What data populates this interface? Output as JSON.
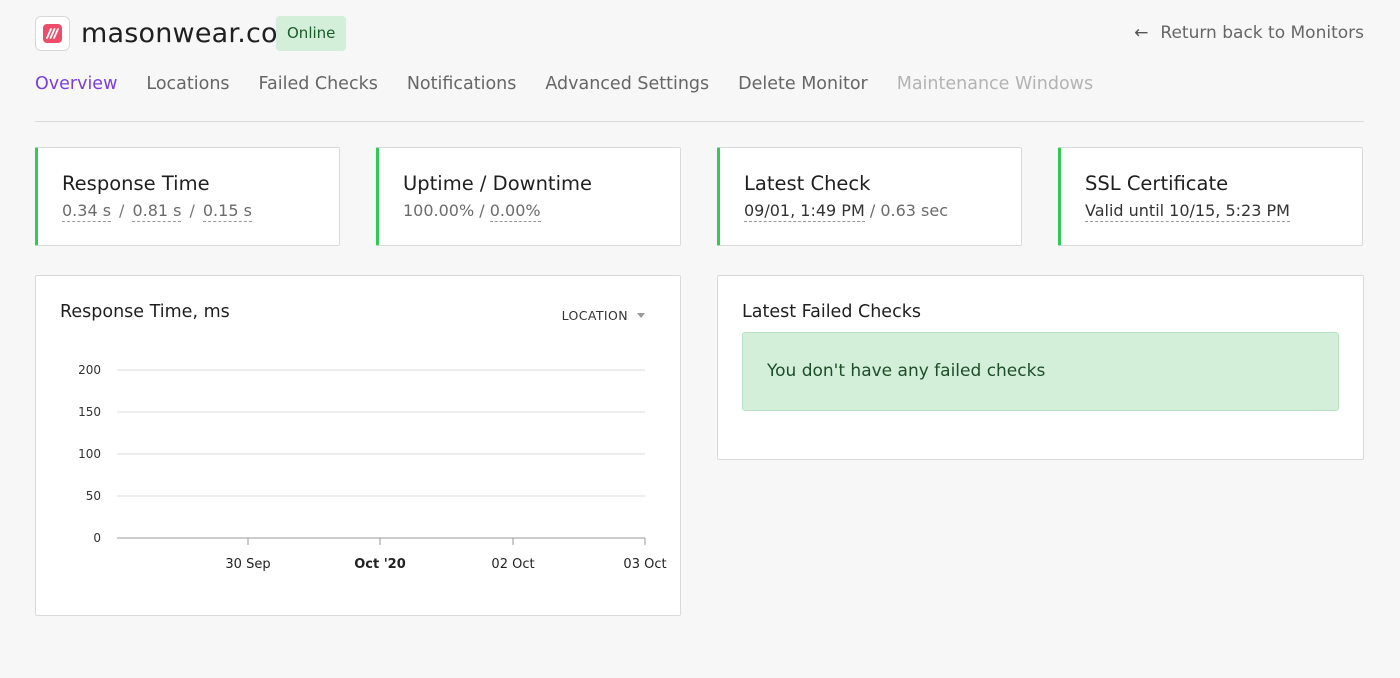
{
  "header": {
    "site_name": "masonwear.co",
    "status": "Online",
    "return_link": "Return back to Monitors",
    "return_arrow": "←",
    "logo_icon": "brand-logo-icon"
  },
  "tabs": [
    {
      "label": "Overview",
      "state": "active"
    },
    {
      "label": "Locations",
      "state": "normal"
    },
    {
      "label": "Failed Checks",
      "state": "normal"
    },
    {
      "label": "Notifications",
      "state": "normal"
    },
    {
      "label": "Advanced Settings",
      "state": "normal"
    },
    {
      "label": "Delete Monitor",
      "state": "normal"
    },
    {
      "label": "Maintenance Windows",
      "state": "disabled"
    }
  ],
  "cards": {
    "response_time": {
      "title": "Response Time",
      "v1": "0.34 s",
      "v2": "0.81 s",
      "v3": "0.15 s",
      "sep": "/"
    },
    "uptime": {
      "title": "Uptime / Downtime",
      "uptime": "100.00%",
      "sep": " / ",
      "downtime": "0.00%"
    },
    "latest_check": {
      "title": "Latest Check",
      "time": "09/01, 1:49 PM",
      "duration": " / 0.63 sec"
    },
    "ssl": {
      "title": "SSL Certificate",
      "value": "Valid until 10/15, 5:23 PM"
    }
  },
  "colors": {
    "accent": "#7b3fd6",
    "success": "#2ecc52",
    "badge_bg": "#d3efd9"
  },
  "response_panel": {
    "title": "Response Time, ms",
    "location_label": "LOCATION"
  },
  "failed_panel": {
    "title": "Latest Failed Checks",
    "empty_message": "You don't have any failed checks"
  },
  "chart_data": {
    "type": "line",
    "title": "Response Time, ms",
    "xlabel": "",
    "ylabel": "",
    "ylim": [
      0,
      200
    ],
    "y_ticks": [
      0,
      50,
      100,
      150,
      200
    ],
    "x_ticks": [
      {
        "label": "30 Sep",
        "bold": false
      },
      {
        "label": "Oct '20",
        "bold": true
      },
      {
        "label": "02 Oct",
        "bold": false
      },
      {
        "label": "03 Oct",
        "bold": false
      }
    ],
    "series": [],
    "grid": true
  }
}
